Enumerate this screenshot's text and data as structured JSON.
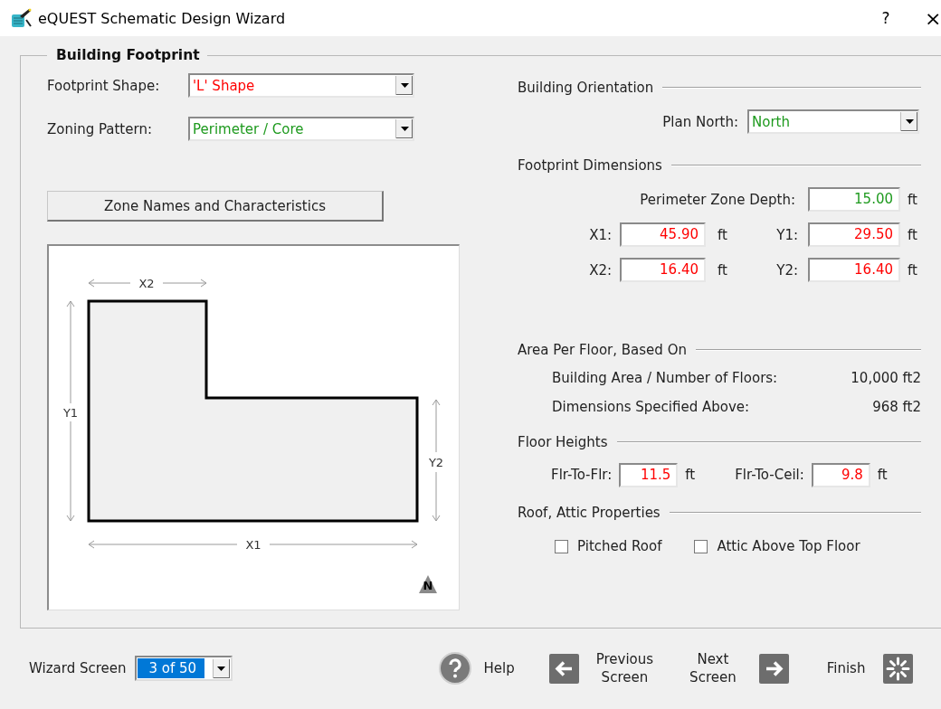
{
  "window": {
    "title": "eQUEST Schematic Design Wizard",
    "help": "?",
    "close": "×"
  },
  "group_title": "Building Footprint",
  "selects": [
    {
      "label": "Footprint Shape:",
      "value": "'L' Shape",
      "color": "#ff0000"
    },
    {
      "label": "Zoning Pattern:",
      "value": "Perimeter / Core",
      "color": "#1e9a1e"
    }
  ],
  "zone_button": "Zone Names and Characteristics",
  "diagram": {
    "x2": "X2",
    "y1": "Y1",
    "y2": "Y2",
    "x1": "X1",
    "north": "N"
  },
  "orientation": {
    "title": "Building Orientation",
    "label": "Plan North:",
    "value": "North",
    "color": "#1e9a1e"
  },
  "dimensions": {
    "title": "Footprint Dimensions",
    "depth": {
      "label": "Perimeter Zone Depth:",
      "value": "15.00",
      "unit": "ft",
      "color": "#1e9a1e"
    },
    "fields": [
      {
        "label": "X1:",
        "value": "45.90",
        "unit": "ft",
        "color": "#ff0000"
      },
      {
        "label": "Y1:",
        "value": "29.50",
        "unit": "ft",
        "color": "#ff0000"
      },
      {
        "label": "X2:",
        "value": "16.40",
        "unit": "ft",
        "color": "#ff0000"
      },
      {
        "label": "Y2:",
        "value": "16.40",
        "unit": "ft",
        "color": "#ff0000"
      }
    ]
  },
  "area": {
    "title": "Area Per Floor, Based On",
    "rows": [
      {
        "label": "Building Area / Number of Floors:",
        "value": "10,000 ft2"
      },
      {
        "label": "Dimensions Specified Above:",
        "value": "968 ft2"
      }
    ]
  },
  "heights": {
    "title": "Floor Heights",
    "fields": [
      {
        "label": "Flr-To-Flr:",
        "value": "11.5",
        "unit": "ft",
        "color": "#ff0000"
      },
      {
        "label": "Flr-To-Ceil:",
        "value": "9.8",
        "unit": "ft",
        "color": "#ff0000"
      }
    ]
  },
  "roof": {
    "title": "Roof, Attic Properties",
    "options": [
      {
        "label": "Pitched Roof",
        "checked": false
      },
      {
        "label": "Attic Above Top Floor",
        "checked": false
      }
    ]
  },
  "footer": {
    "label": "Wizard Screen",
    "screen": "3 of 50",
    "buttons": [
      {
        "kind": "help",
        "label": "Help"
      },
      {
        "kind": "previous",
        "label": "Previous Screen"
      },
      {
        "kind": "next",
        "label": "Next Screen"
      },
      {
        "kind": "finish",
        "label": "Finish"
      }
    ]
  }
}
